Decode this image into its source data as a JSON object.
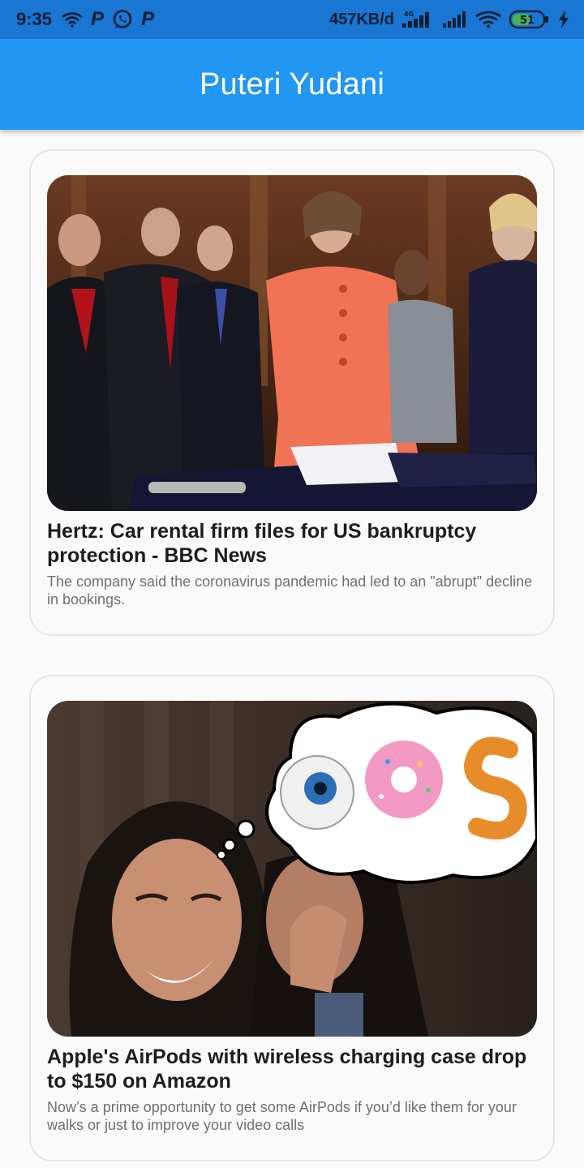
{
  "status_bar": {
    "time": "9:35",
    "network_speed": "457KB/d",
    "network_type": "4G",
    "battery_level": "51",
    "icons": [
      "wifi-icon",
      "p-app-icon",
      "whatsapp-icon",
      "p-app-icon",
      "signal-4g-icon",
      "signal-icon",
      "wifi-icon",
      "battery-icon",
      "charging-icon"
    ]
  },
  "app_bar": {
    "title": "Puteri Yudani"
  },
  "articles": [
    {
      "title": "Hertz: Car rental firm files for US bankruptcy protection - BBC News",
      "description": "The company said the coronavirus pandemic had led to an \"abrupt\" decline in bookings."
    },
    {
      "title": "Apple's AirPods with wireless charging case drop to $150 on Amazon",
      "description": "Now’s a prime opportunity to get some AirPods if you’d like them for your walks or just to improve your video calls"
    }
  ],
  "colors": {
    "status_bar": "#1976d2",
    "app_bar": "#2196f3",
    "background": "#fafafa",
    "title_text": "#1d1d1d",
    "desc_text": "#6f6f6f"
  }
}
